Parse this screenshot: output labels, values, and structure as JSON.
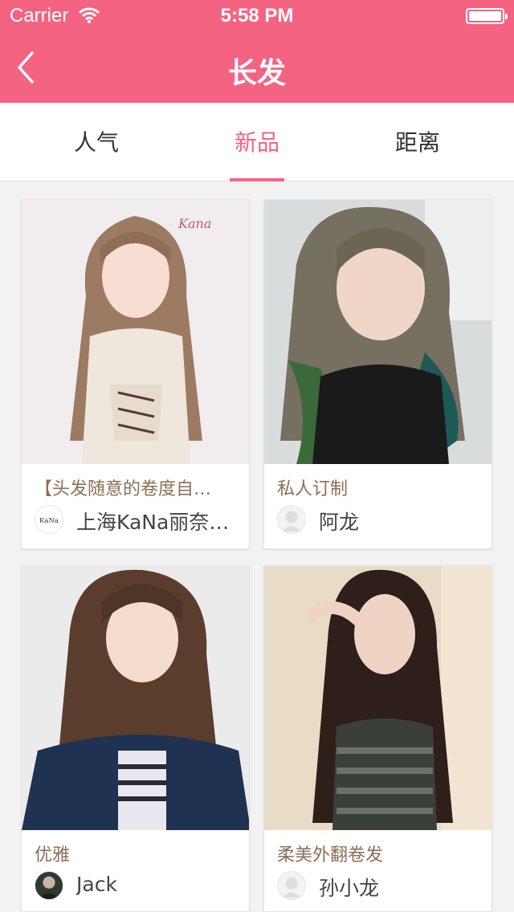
{
  "status_bar": {
    "carrier": "Carrier",
    "time": "5:58 PM"
  },
  "nav": {
    "title": "长发",
    "back_icon": "chevron-left-icon"
  },
  "tabs": [
    {
      "label": "人气",
      "active": false
    },
    {
      "label": "新品",
      "active": true
    },
    {
      "label": "距离",
      "active": false
    }
  ],
  "colors": {
    "brand": "#f56382",
    "card_title": "#8b6f55",
    "background": "#f2f2f2"
  },
  "cards": [
    {
      "title": "【头发随意的卷度自…",
      "author": "上海KaNa丽奈…",
      "photo_watermark": "Kana",
      "avatar_text": "KaNa"
    },
    {
      "title": "私人订制",
      "author": "阿龙"
    },
    {
      "title": "优雅",
      "author": "Jack"
    },
    {
      "title": "柔美外翻卷发",
      "author": "孙小龙"
    }
  ]
}
